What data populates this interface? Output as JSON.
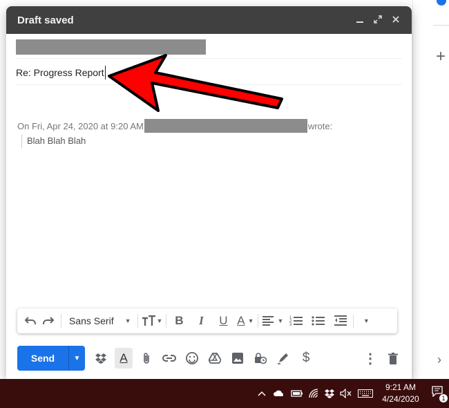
{
  "compose": {
    "status_title": "Draft saved",
    "minimize_glyph": "‗",
    "fullscreen_glyph": "⤢",
    "close_glyph": "✕",
    "subject_value": "Re: Progress Report",
    "quote_prefix": "On Fri, Apr 24, 2020 at 9:20 AM",
    "quote_suffix": "wrote:",
    "quote_body": "Blah Blah Blah"
  },
  "format_toolbar": {
    "undo_glyph": "↶",
    "redo_glyph": "↷",
    "font_family": "Sans Serif",
    "size_glyph": "ᴛT",
    "bold_glyph": "B",
    "italic_glyph": "I",
    "underline_glyph": "U",
    "text_color_glyph": "A",
    "align_glyph": "≡",
    "numbered_list_glyph": "⒈",
    "bulleted_list_glyph": "•≡",
    "indent_glyph": "⇤",
    "more_glyph": "▾"
  },
  "bottom_toolbar": {
    "send_label": "Send",
    "send_options_glyph": "▼",
    "dropbox_glyph": "❖",
    "formatting_glyph": "A",
    "attach_glyph": "⌇",
    "link_glyph": "⚭",
    "emoji_glyph": "☺",
    "drive_glyph": "△",
    "photo_glyph": "▣",
    "confidential_glyph": "⏲",
    "signature_glyph": "✎",
    "money_glyph": "$",
    "more_options_glyph": "⋮",
    "discard_glyph": "🗑"
  },
  "side_panel": {
    "add_glyph": "+",
    "expand_glyph": "›"
  },
  "taskbar": {
    "time": "9:21 AM",
    "date": "4/24/2020",
    "notification_count": "1",
    "tray_icons": [
      "chevron-up-icon",
      "onedrive-icon",
      "battery-icon",
      "wifi-icon",
      "dropbox-icon",
      "volume-muted-icon",
      "keyboard-icon"
    ]
  },
  "colors": {
    "send_blue": "#1a73e8",
    "title_bar": "#404040",
    "taskbar": "#3a0d0d",
    "arrow": "#ff0000",
    "redaction": "#8c8c8c"
  }
}
